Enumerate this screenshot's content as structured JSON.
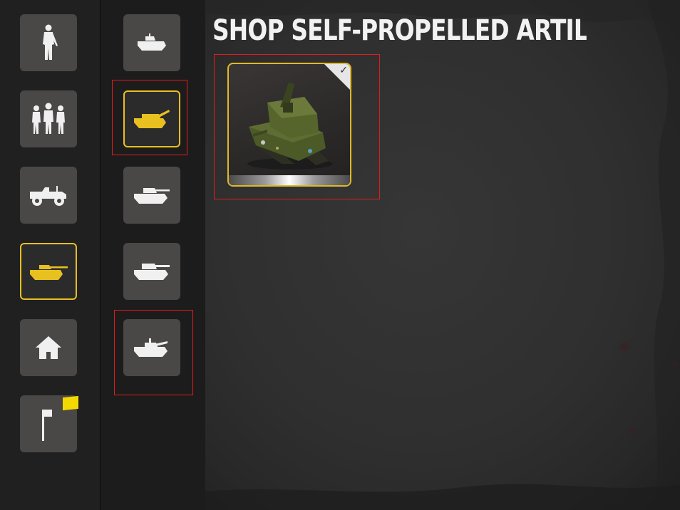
{
  "header": {
    "title": "SHOP SELF-PROPELLED ARTILLERY"
  },
  "categories": [
    {
      "id": "infantry",
      "icon": "soldier-icon",
      "selected": false
    },
    {
      "id": "squads",
      "icon": "squad-icon",
      "selected": false
    },
    {
      "id": "vehicles",
      "icon": "jeep-icon",
      "selected": false
    },
    {
      "id": "tanks",
      "icon": "tank-icon",
      "selected": true
    },
    {
      "id": "buildings",
      "icon": "house-icon",
      "selected": false
    },
    {
      "id": "flags",
      "icon": "flag-icon",
      "selected": false,
      "has_new_badge": true
    }
  ],
  "subcategories": [
    {
      "id": "light-tank",
      "icon": "light-tank-icon",
      "selected": false
    },
    {
      "id": "self-propelled-artillery",
      "icon": "spg-icon",
      "selected": true
    },
    {
      "id": "medium-tank",
      "icon": "medium-tank-icon",
      "selected": false
    },
    {
      "id": "heavy-tank",
      "icon": "heavy-tank-icon",
      "selected": false
    },
    {
      "id": "tank-destroyer",
      "icon": "tank-destroyer-icon",
      "selected": false
    }
  ],
  "items": [
    {
      "icon": "self-propelled-gun-image",
      "owned": true,
      "check": "✓"
    }
  ],
  "colors": {
    "accent": "#e8c020",
    "highlight": "#e21b1b",
    "tile": "#4a4747",
    "badge": "#f3d900"
  }
}
